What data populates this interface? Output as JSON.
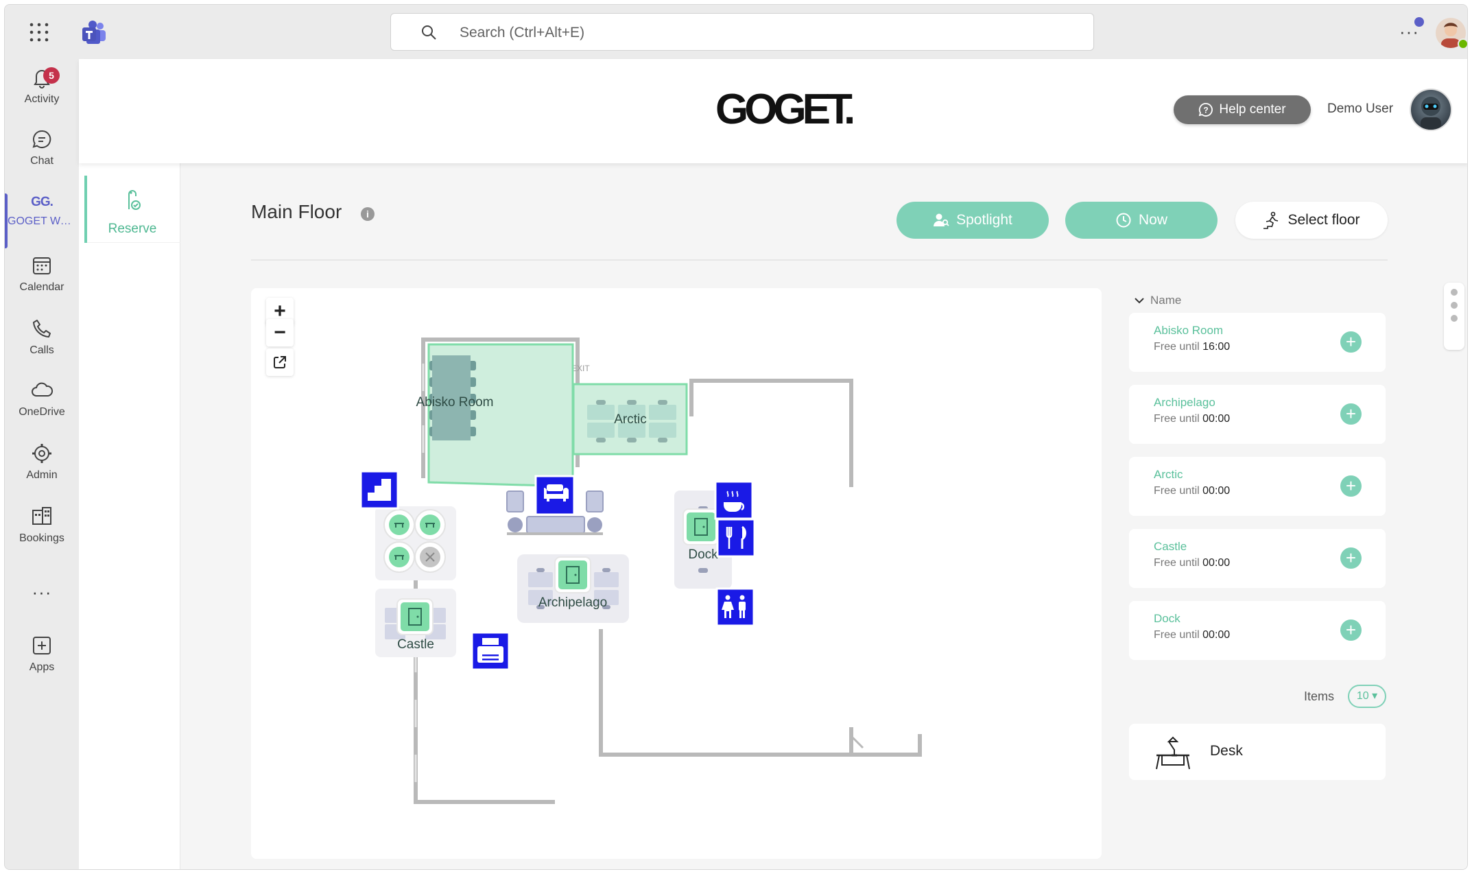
{
  "teams": {
    "search_placeholder": "Search (Ctrl+Alt+E)",
    "more": "···",
    "rail": [
      {
        "label": "Activity",
        "icon": "bell-icon",
        "badge": "5"
      },
      {
        "label": "Chat",
        "icon": "chat-icon"
      },
      {
        "label": "GOGET Wor...",
        "icon": "goget-app-icon",
        "icon_text": "GG.",
        "active": true
      },
      {
        "label": "Calendar",
        "icon": "calendar-icon"
      },
      {
        "label": "Calls",
        "icon": "phone-icon"
      },
      {
        "label": "OneDrive",
        "icon": "cloud-icon"
      },
      {
        "label": "Admin",
        "icon": "admin-icon"
      },
      {
        "label": "Bookings",
        "icon": "bookings-icon"
      },
      {
        "label": "···",
        "icon": "more-icon"
      },
      {
        "label": "Apps",
        "icon": "apps-icon"
      }
    ],
    "accent": "#5b5fc7"
  },
  "app": {
    "logo": "GOGET.",
    "help_center": "Help center",
    "user_name": "Demo User",
    "nav_reserve": "Reserve",
    "accent": "#7fd1b7"
  },
  "main": {
    "floor_title": "Main Floor",
    "info": "i",
    "spotlight": "Spotlight",
    "now": "Now",
    "select_floor": "Select floor"
  },
  "map": {
    "zoom_in": "+",
    "zoom_out": "−",
    "exit_label": "EXIT",
    "rooms": {
      "abisko": "Abisko Room",
      "arctic": "Arctic",
      "archipelago": "Archipelago",
      "castle": "Castle",
      "dock": "Dock"
    },
    "amenity_icons": [
      "stairs-icon",
      "lounge-icon",
      "coffee-icon",
      "cutlery-icon",
      "restroom-icon",
      "printer-icon"
    ],
    "amenity_color": "#1a1ae6"
  },
  "list": {
    "sort_label": "Name",
    "spaces": [
      {
        "name": "Abisko Room",
        "free_prefix": "Free until",
        "time": "16:00"
      },
      {
        "name": "Archipelago",
        "free_prefix": "Free until",
        "time": "00:00"
      },
      {
        "name": "Arctic",
        "free_prefix": "Free until",
        "time": "00:00"
      },
      {
        "name": "Castle",
        "free_prefix": "Free until",
        "time": "00:00"
      },
      {
        "name": "Dock",
        "free_prefix": "Free until",
        "time": "00:00"
      }
    ],
    "items_label": "Items",
    "items_value": "10 ▾",
    "desk_label": "Desk"
  }
}
